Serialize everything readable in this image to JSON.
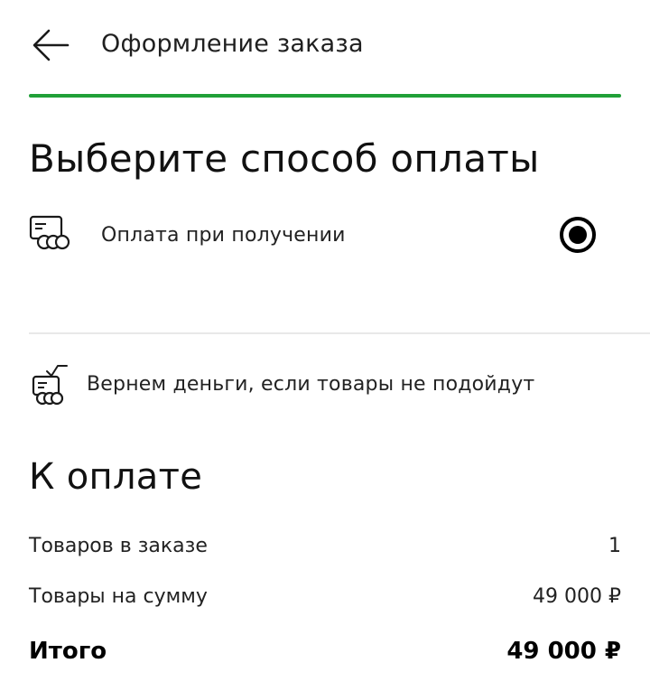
{
  "header": {
    "title": "Оформление заказа",
    "back_icon": "arrow-left-icon",
    "progress_fraction": 1.0,
    "progress_color": "#21a038"
  },
  "payment": {
    "title": "Выберите способ оплаты",
    "options": [
      {
        "label": "Оплата при получении",
        "icon": "card-coins-icon",
        "selected": true
      }
    ]
  },
  "refund": {
    "icon": "card-check-coins-icon",
    "text": "Вернем деньги, если товары не подойдут"
  },
  "summary": {
    "title": "К оплате",
    "rows": [
      {
        "label": "Товаров в заказе",
        "value": "1"
      },
      {
        "label": "Товары на сумму",
        "value": "49 000 ₽"
      }
    ],
    "total": {
      "label": "Итого",
      "value": "49 000 ₽"
    }
  },
  "colors": {
    "accent": "#21a038",
    "text": "#1a1a1a",
    "divider": "#e8e8e8"
  }
}
